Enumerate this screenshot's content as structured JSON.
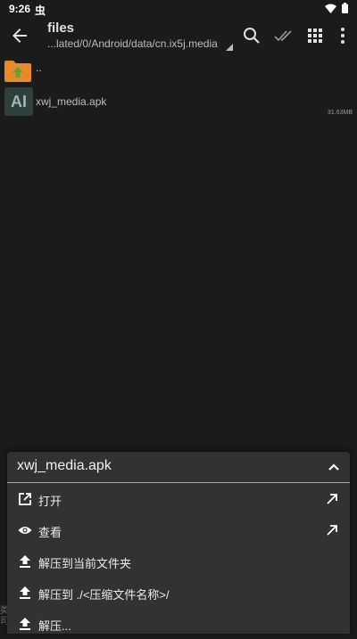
{
  "status": {
    "time": "9:26",
    "bug_glyph": "虫",
    "icons": [
      "wifi-icon",
      "battery-icon"
    ]
  },
  "toolbar": {
    "title": "files",
    "path": "...lated/0/Android/data/cn.ix5j.media",
    "icons": [
      "back-icon",
      "search-icon",
      "check-all-icon",
      "grid-view-icon",
      "more-vert-icon"
    ]
  },
  "files": {
    "parent_label": "..",
    "apk": {
      "icon_text": "AI",
      "name": "xwj_media.apk",
      "size": "31.63MB"
    }
  },
  "behind_text": "类\n司",
  "sheet": {
    "title": "xwj_media.apk",
    "items": [
      {
        "label": "打开",
        "icon": "open-external-icon",
        "trail": "arrow-up-right-icon"
      },
      {
        "label": "查看",
        "icon": "eye-icon",
        "trail": "arrow-up-right-icon"
      },
      {
        "label": "解压到当前文件夹",
        "icon": "upload-icon"
      },
      {
        "label": "解压到 ./<压缩文件名称>/",
        "icon": "upload-icon"
      },
      {
        "label": "解压...",
        "icon": "upload-icon"
      }
    ]
  },
  "colors": {
    "background": "#1b1b1b",
    "sheet": "#323232",
    "accent_divider": "#e0976a"
  }
}
